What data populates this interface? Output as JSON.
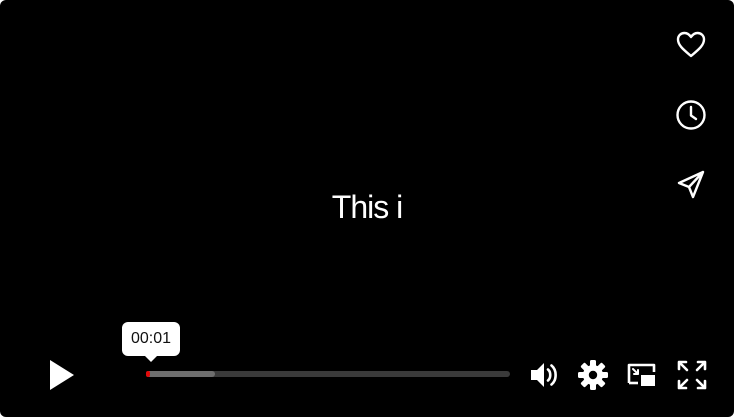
{
  "video": {
    "caption_text": "This i"
  },
  "side_actions": [
    {
      "name": "like",
      "icon": "heart-outline-icon"
    },
    {
      "name": "watch-later",
      "icon": "clock-icon"
    },
    {
      "name": "share",
      "icon": "send-plane-icon"
    }
  ],
  "controls": {
    "play_icon": "play-icon",
    "tooltip_time": "00:01",
    "progress_played_fraction": 0.005,
    "progress_buffered_fraction": 0.19,
    "icons": [
      "volume-icon",
      "gear-icon",
      "picture-in-picture-icon",
      "fullscreen-icon"
    ]
  },
  "colors": {
    "background": "#000000",
    "played": "#e00a0a",
    "buffered": "#6e6e6e",
    "track": "#3a3a3a",
    "icon": "#ffffff"
  }
}
